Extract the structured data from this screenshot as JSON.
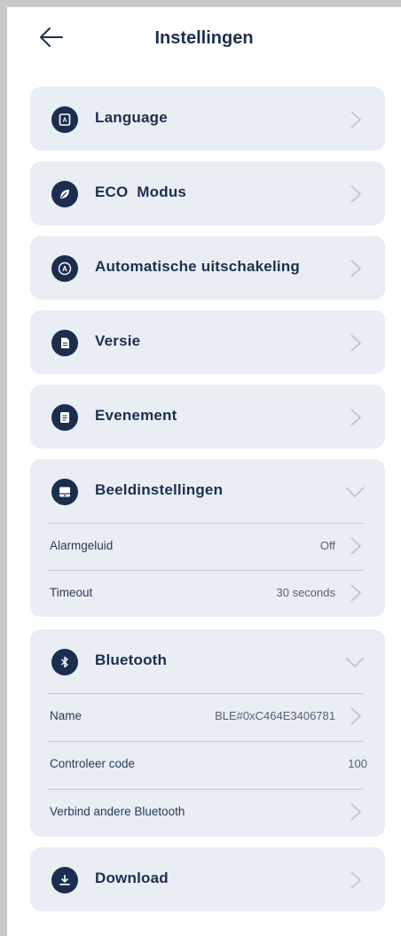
{
  "header": {
    "title": "Instellingen",
    "title_overlay": "Instellingen"
  },
  "menu": {
    "language": "Language",
    "eco": "ECO  Modus",
    "auto_off": "Automatische uitschakeling",
    "version": "Versie",
    "event": "Evenement",
    "display": "Beeldinstellingen",
    "bluetooth": "Bluetooth",
    "download": "Download"
  },
  "display_settings": {
    "alarm": {
      "label": "Alarmgeluid",
      "value": "Off"
    },
    "timeout": {
      "label": "Timeout",
      "value": "30 seconds"
    }
  },
  "bluetooth_settings": {
    "name": {
      "label": "Name",
      "value": "BLE#0xC464E3406781"
    },
    "code": {
      "label": "Controleer code",
      "value": "100"
    },
    "connect": {
      "label": "Verbind andere Bluetooth"
    }
  },
  "colors": {
    "accent": "#1c2e4e",
    "card": "#e9eef5",
    "chevron": "#b9c2ce"
  },
  "icons": {
    "back": "arrow-left-icon",
    "language": "language-icon",
    "eco": "leaf-icon",
    "auto_off": "auto-icon",
    "version": "document-icon",
    "event": "event-list-icon",
    "display": "monitor-icon",
    "bluetooth": "bluetooth-icon",
    "download": "download-icon"
  }
}
